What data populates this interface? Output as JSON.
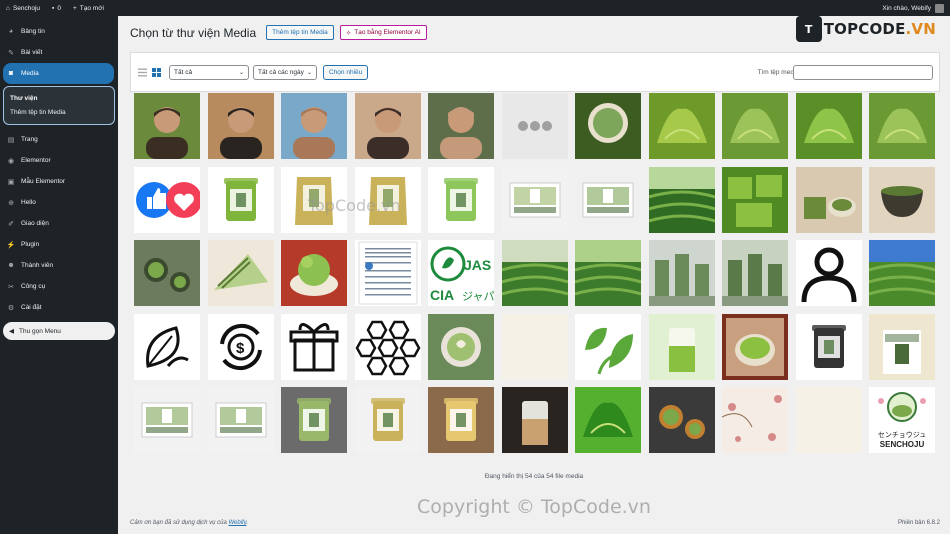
{
  "adminbar": {
    "site_name": "Senchoju",
    "comments_count": "0",
    "new_label": "Tạo mới",
    "greeting": "Xin chào, Webify"
  },
  "sidebar": {
    "items": [
      {
        "label": "Bảng tin",
        "icon": "dashboard-icon"
      },
      {
        "label": "Bài viết",
        "icon": "pin-icon"
      },
      {
        "label": "Media",
        "icon": "media-icon",
        "active": true
      },
      {
        "label": "Trang",
        "icon": "page-icon"
      },
      {
        "label": "Elementor",
        "icon": "elementor-icon"
      },
      {
        "label": "Mẫu Elementor",
        "icon": "folder-icon"
      },
      {
        "label": "Hello",
        "icon": "plus-circle-icon"
      },
      {
        "label": "Giao diện",
        "icon": "brush-icon"
      },
      {
        "label": "Plugin",
        "icon": "plugin-icon"
      },
      {
        "label": "Thành viên",
        "icon": "users-icon"
      },
      {
        "label": "Công cụ",
        "icon": "wrench-icon"
      },
      {
        "label": "Cài đặt",
        "icon": "settings-icon"
      }
    ],
    "submenu": {
      "library": "Thư viện",
      "add_new": "Thêm tệp tin Media"
    },
    "collapse_label": "Thu gọn Menu"
  },
  "header": {
    "title": "Chọn từ thư viện Media",
    "add_media_button": "Thêm tệp tin Media",
    "elementor_ai_button": "Tạo bằng Elementor AI"
  },
  "logo": {
    "mark": "T",
    "text_main": "TOPCODE",
    "text_tld": ".VN"
  },
  "toolbar": {
    "filter_type": "Tất cả",
    "filter_date": "Tất cả các ngày",
    "bulk_select": "Chọn nhiều",
    "search_label": "Tìm tệp media",
    "search_value": ""
  },
  "media": {
    "items": [
      {
        "name": "portrait",
        "colors": [
          "#6b8a3c",
          "#3a2e22"
        ]
      },
      {
        "name": "portrait",
        "colors": [
          "#b88b5e",
          "#2a2420"
        ]
      },
      {
        "name": "portrait",
        "colors": [
          "#7aa8c8",
          "#a87858"
        ]
      },
      {
        "name": "portrait",
        "colors": [
          "#c9a98a",
          "#3b2e28"
        ]
      },
      {
        "name": "portrait",
        "colors": [
          "#5e6e4a",
          "#c49a7a"
        ]
      },
      {
        "name": "placeholder",
        "colors": [
          "#e8e8e8",
          "#a0a0a0"
        ]
      },
      {
        "name": "matcha-cup",
        "colors": [
          "#7da65a",
          "#3d5c22"
        ]
      },
      {
        "name": "matcha-powder",
        "colors": [
          "#a6c94a",
          "#6e9a2a"
        ]
      },
      {
        "name": "matcha-powder",
        "colors": [
          "#9bc35a",
          "#6b9a34"
        ]
      },
      {
        "name": "matcha-powder",
        "colors": [
          "#8ec548",
          "#5a8f28"
        ]
      },
      {
        "name": "matcha-powder",
        "colors": [
          "#9bc35a",
          "#6b9a34"
        ]
      },
      {
        "name": "social-icons",
        "colors": [
          "#1877f2",
          "#f33e58"
        ]
      },
      {
        "name": "tin",
        "colors": [
          "#ffffff",
          "#7fb53a"
        ]
      },
      {
        "name": "bag",
        "colors": [
          "#ffffff",
          "#c9b25a"
        ]
      },
      {
        "name": "bag",
        "colors": [
          "#ffffff",
          "#c9b25a"
        ]
      },
      {
        "name": "tin",
        "colors": [
          "#ffffff",
          "#8dc65a"
        ]
      },
      {
        "name": "box",
        "colors": [
          "#f2f2f2",
          "#9ab86a"
        ]
      },
      {
        "name": "box",
        "colors": [
          "#f0f0f0",
          "#7fa55a"
        ]
      },
      {
        "name": "tea-field",
        "colors": [
          "#b7d89a",
          "#2f6b22"
        ]
      },
      {
        "name": "matcha-cube",
        "colors": [
          "#8cc040",
          "#4f8a22"
        ]
      },
      {
        "name": "matcha-tin",
        "colors": [
          "#d9c9b0",
          "#6b8a3a"
        ]
      },
      {
        "name": "tea-bowl",
        "colors": [
          "#e2d5c0",
          "#3d3a30"
        ]
      },
      {
        "name": "tea-set",
        "colors": [
          "#6c7a5e",
          "#3b4a2e"
        ]
      },
      {
        "name": "matcha-cake",
        "colors": [
          "#b5d08a",
          "#5a7a34"
        ]
      },
      {
        "name": "matcha-icecream",
        "colors": [
          "#b53a2a",
          "#8cc050"
        ]
      },
      {
        "name": "certificate",
        "colors": [
          "#ffffff",
          "#7a8aa0"
        ]
      },
      {
        "name": "jas-logo",
        "colors": [
          "#ffffff",
          "#1e8a3c"
        ]
      },
      {
        "name": "tea-field",
        "colors": [
          "#d0dcc0",
          "#3c7a2c"
        ]
      },
      {
        "name": "tea-field",
        "colors": [
          "#aed18a",
          "#3c7a2c"
        ]
      },
      {
        "name": "factory",
        "colors": [
          "#cfd6cf",
          "#6a8a5a"
        ]
      },
      {
        "name": "factory",
        "colors": [
          "#c8d2c0",
          "#5a7a4a"
        ]
      },
      {
        "name": "user-icon",
        "colors": [
          "#ffffff",
          "#111111"
        ]
      },
      {
        "name": "tea-field",
        "colors": [
          "#3d7ad0",
          "#4a8a2a"
        ]
      },
      {
        "name": "leaf-icon",
        "colors": [
          "#ffffff",
          "#111111"
        ]
      },
      {
        "name": "money-icon",
        "colors": [
          "#ffffff",
          "#111111"
        ]
      },
      {
        "name": "gift-icon",
        "colors": [
          "#ffffff",
          "#111111"
        ]
      },
      {
        "name": "hex-icon",
        "colors": [
          "#ffffff",
          "#111111"
        ]
      },
      {
        "name": "matcha-latte",
        "colors": [
          "#e8e2d8",
          "#6a8a5a"
        ]
      },
      {
        "name": "blank",
        "colors": [
          "#f6f1e6",
          "#f6f1e6"
        ]
      },
      {
        "name": "leaf-logo",
        "colors": [
          "#ffffff",
          "#5aa83a"
        ]
      },
      {
        "name": "matcha-drink",
        "colors": [
          "#e2f0d2",
          "#8ac040"
        ]
      },
      {
        "name": "matcha-bowl",
        "colors": [
          "#7a2e1e",
          "#8cc040"
        ]
      },
      {
        "name": "tin",
        "colors": [
          "#ffffff",
          "#333333"
        ]
      },
      {
        "name": "tin-label",
        "colors": [
          "#efe6d0",
          "#4a6a3a"
        ]
      },
      {
        "name": "box",
        "colors": [
          "#f2f2f2",
          "#7fa55a"
        ]
      },
      {
        "name": "box",
        "colors": [
          "#f2f2f2",
          "#7fa55a"
        ]
      },
      {
        "name": "tin",
        "colors": [
          "#6b6b6b",
          "#9ab86a"
        ]
      },
      {
        "name": "tin",
        "colors": [
          "#f2f2f2",
          "#c9b25a"
        ]
      },
      {
        "name": "tin",
        "colors": [
          "#8a6a4a",
          "#e6c870"
        ]
      },
      {
        "name": "matcha-drink",
        "colors": [
          "#2a2420",
          "#c9a070"
        ]
      },
      {
        "name": "matcha-powder",
        "colors": [
          "#2f8a1e",
          "#56b030"
        ]
      },
      {
        "name": "tea-set",
        "colors": [
          "#3a3a3a",
          "#c08030"
        ]
      },
      {
        "name": "blossom",
        "colors": [
          "#f6ece6",
          "#d58a8a"
        ]
      },
      {
        "name": "blank",
        "colors": [
          "#f6f1e6",
          "#f6f1e6"
        ]
      },
      {
        "name": "senchoju-logo",
        "colors": [
          "#ffffff",
          "#3a7a3a"
        ]
      }
    ],
    "senchoju_text": "SENCHOJU",
    "senchoju_jp": "センチョウジュ"
  },
  "status_text": "Đang hiển thị 54 của 54 file media",
  "watermarks": {
    "center": "TopCode.vn",
    "footer": "Copyright © TopCode.vn"
  },
  "footer": {
    "thanks_prefix": "Cảm ơn bạn đã sử dụng dịch vụ của ",
    "thanks_link": "Webify",
    "thanks_suffix": ".",
    "version": "Phiên bản 6.8.2"
  }
}
